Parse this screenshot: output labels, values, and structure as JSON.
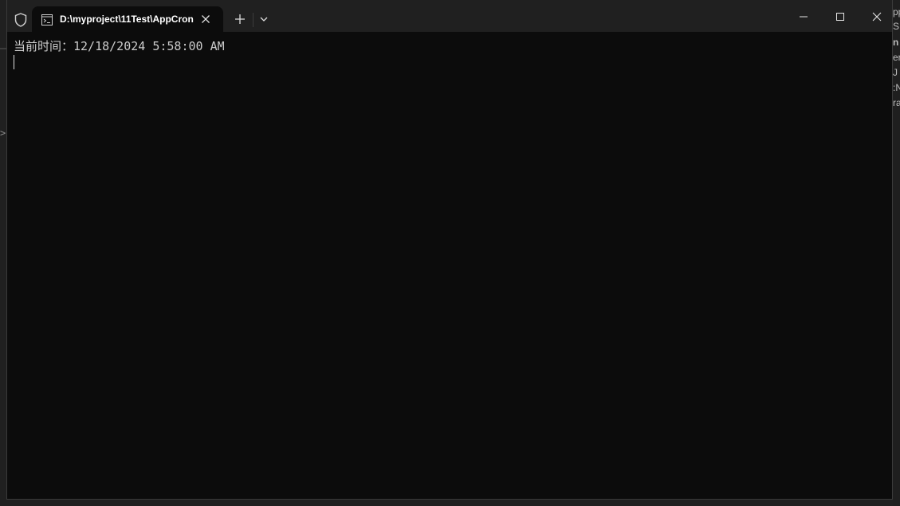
{
  "window": {
    "tab_title": "D:\\myproject\\11Test\\AppCron"
  },
  "terminal": {
    "lines": [
      "当前时间：12/18/2024 5:58:00 AM"
    ]
  },
  "backdrop": {
    "chevron": ">",
    "right_fragments": [
      "pp",
      "S",
      "n",
      "er",
      "J",
      ":N",
      "ra"
    ]
  },
  "icons": {
    "shield": "shield-icon",
    "tab": "terminal-icon",
    "close_tab": "close-icon",
    "new_tab": "plus-icon",
    "dropdown": "chevron-down-icon",
    "minimize": "minimize-icon",
    "maximize": "maximize-icon",
    "close_window": "close-icon"
  },
  "colors": {
    "terminal_bg": "#0c0c0c",
    "titlebar_bg": "#202020",
    "text": "#cccccc"
  }
}
